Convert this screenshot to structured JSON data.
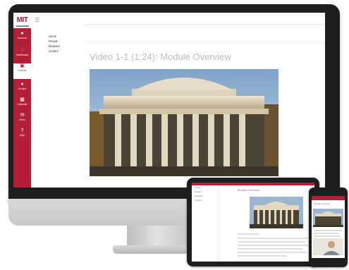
{
  "brand": {
    "logo_text": "MIT",
    "accent_color": "#b41e37"
  },
  "sidebar": {
    "items": [
      {
        "label": "Account",
        "icon": "user-icon"
      },
      {
        "label": "Dashboard",
        "icon": "dashboard-icon"
      },
      {
        "label": "Courses",
        "icon": "book-icon"
      },
      {
        "label": "Groups",
        "icon": "groups-icon"
      },
      {
        "label": "Calendar",
        "icon": "calendar-icon"
      },
      {
        "label": "Inbox",
        "icon": "inbox-icon"
      },
      {
        "label": "Help",
        "icon": "help-icon"
      }
    ],
    "active_index": 2
  },
  "course_nav": {
    "items": [
      "Home",
      "People",
      "Modules",
      "Grades"
    ]
  },
  "page": {
    "title": "Video 1-1 (1:24): Module Overview"
  },
  "tablet": {
    "title": "Module Overview",
    "nav_items": [
      "Home",
      "People",
      "Modules",
      "Grades"
    ]
  },
  "phone": {
    "title": "Module Overview"
  }
}
